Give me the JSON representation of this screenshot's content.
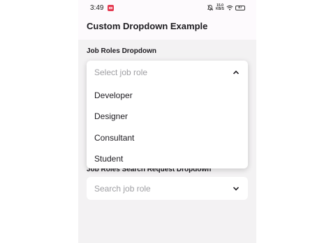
{
  "status_bar": {
    "time": "3:49",
    "network_top": "15.0",
    "network_bottom": "KB/S",
    "battery": "87"
  },
  "app_bar": {
    "title": "Custom Dropdown Example"
  },
  "job_roles_dropdown": {
    "label": "Job Roles Dropdown",
    "placeholder": "Select job role",
    "expanded": true,
    "options": [
      "Developer",
      "Designer",
      "Consultant",
      "Student"
    ]
  },
  "search_dropdown": {
    "label": "Job Roles Search Request Dropdown",
    "placeholder": "Search job role"
  },
  "colors": {
    "background": "#f3f2f3",
    "app_bar": "#fdfafd",
    "surface": "#ffffff",
    "placeholder": "#9e9ea2",
    "text": "#1d1b20",
    "notification": "#e53950"
  },
  "icons": {
    "notification": "app-notification-icon",
    "mute": "bell-off-icon",
    "wifi": "wifi-icon",
    "battery": "battery-icon",
    "expanded": "chevron-up-icon",
    "collapsed": "chevron-down-icon"
  }
}
